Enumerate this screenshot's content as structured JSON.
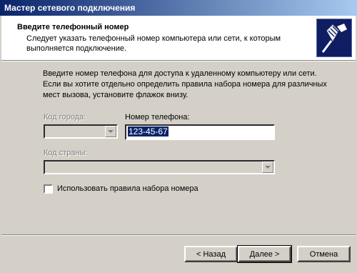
{
  "window": {
    "title": "Мастер сетевого подключения"
  },
  "header": {
    "title": "Введите телефонный номер",
    "subtitle": "Следует указать телефонный номер компьютера или сети, к которым выполняется подключение.",
    "icon": "network-cable-icon"
  },
  "body": {
    "instruction": "Введите номер телефона для доступа к удаленному компьютеру или сети. Если вы хотите отдельно определить правила набора номера для различных мест вызова, установите флажок внизу."
  },
  "form": {
    "area_code_label": "Код города:",
    "area_code_value": "",
    "phone_label": "Номер телефона:",
    "phone_value": "123-45-67",
    "country_label": "Код страны:",
    "country_value": "",
    "dialing_rules_label": "Использовать правила набора номера",
    "dialing_rules_checked": false
  },
  "buttons": {
    "back": "< Назад",
    "next": "Далее >",
    "cancel": "Отмена"
  }
}
